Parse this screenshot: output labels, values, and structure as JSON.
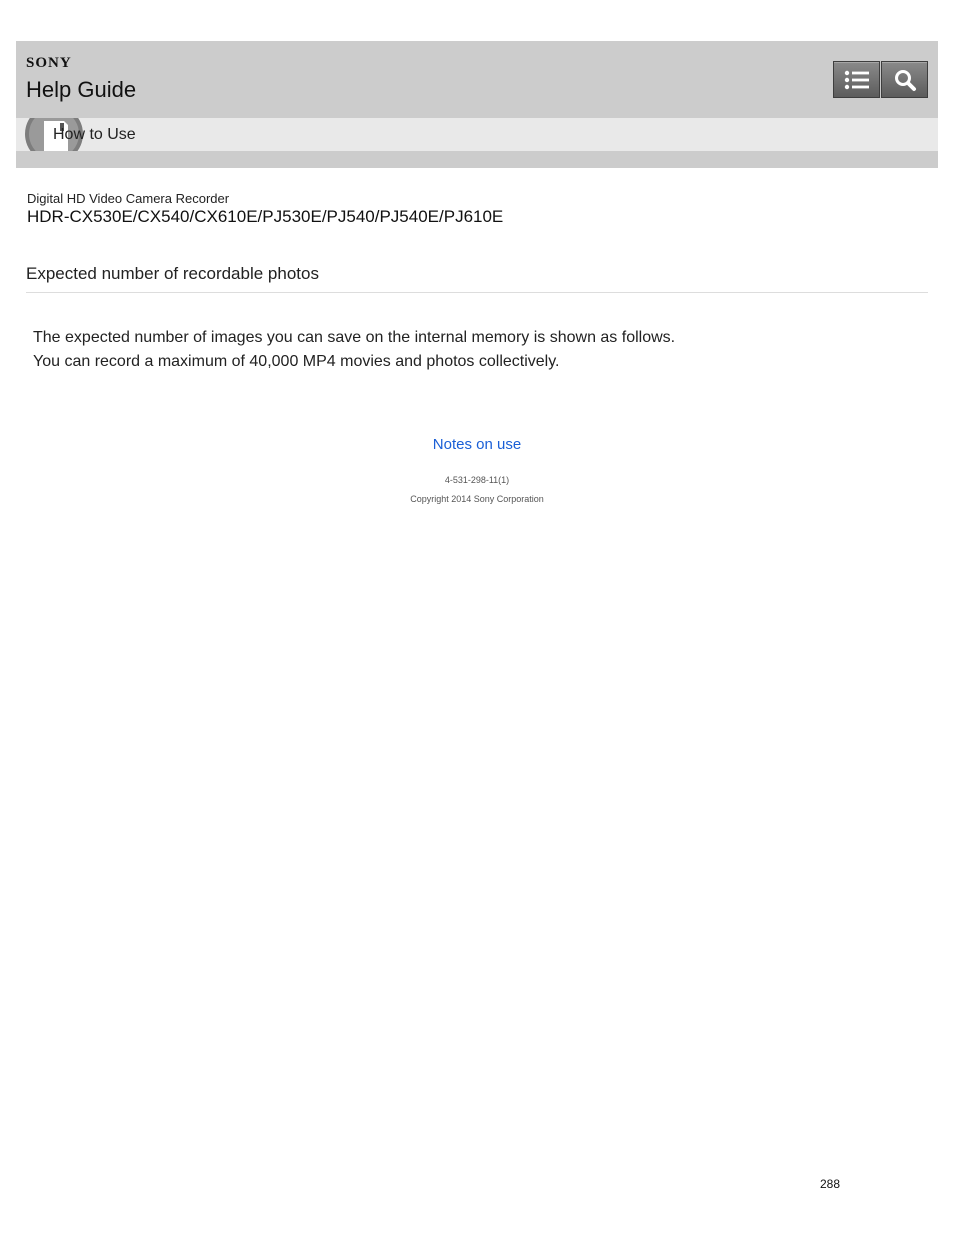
{
  "header": {
    "brand": "SONY",
    "title": "Help Guide",
    "buttons": [
      {
        "icon": "list-icon"
      },
      {
        "icon": "search-icon"
      }
    ]
  },
  "breadcrumb": {
    "icon": "camera-icon",
    "label": "How to Use"
  },
  "product": {
    "category": "Digital HD Video Camera Recorder",
    "models": "HDR-CX530E/CX540/CX610E/PJ530E/PJ540/PJ540E/PJ610E"
  },
  "page_title": "Expected number of recordable photos",
  "body": [
    "The expected number of images you can save on the internal memory is shown as follows.",
    "You can record a maximum of 40,000 MP4 movies and photos collectively."
  ],
  "footer": {
    "link": "Notes on use",
    "doc_id": "4-531-298-11(1)",
    "copyright": "Copyright 2014 Sony Corporation",
    "page_number": "288"
  },
  "colors": {
    "header_bg": "#cccccc",
    "crumb_bg": "#e9e9e9",
    "link": "#1a5fd6"
  }
}
